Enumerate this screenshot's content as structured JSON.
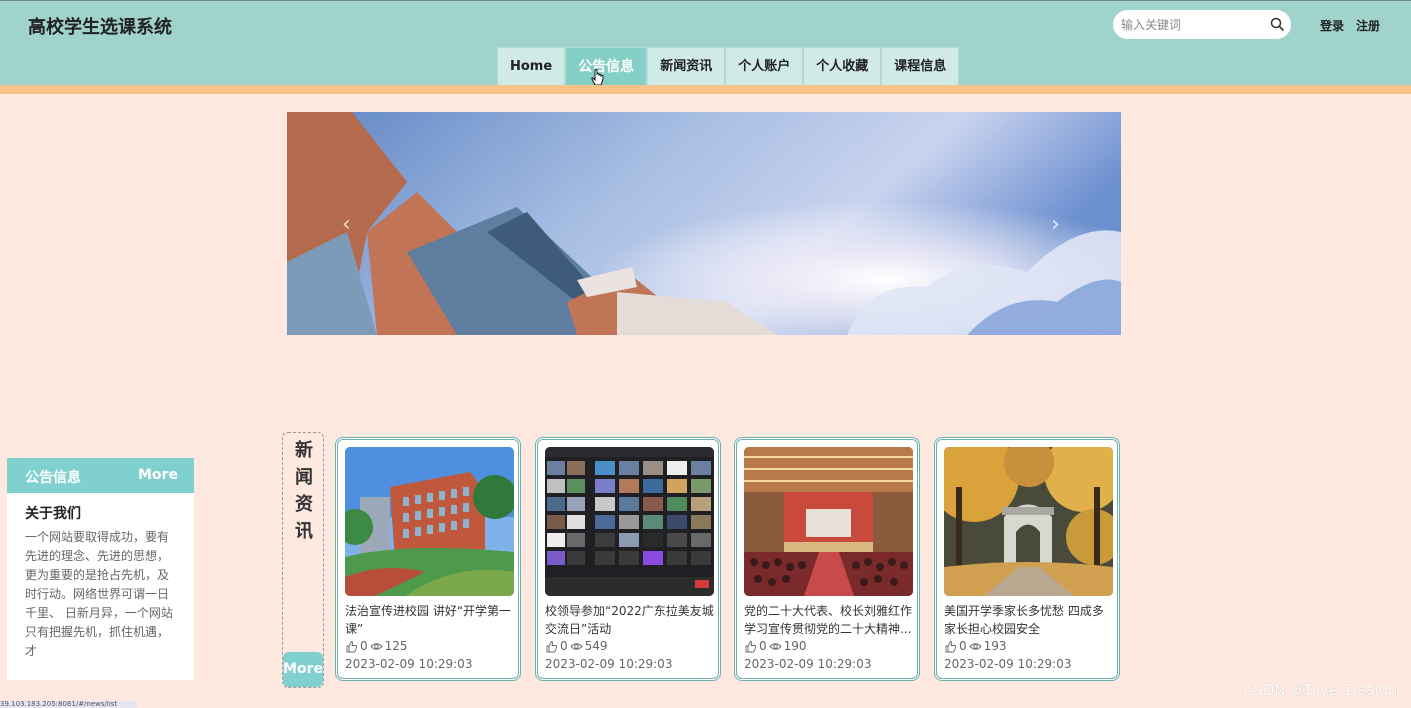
{
  "header": {
    "site_title": "高校学生选课系统",
    "search_placeholder": "输入关键词",
    "login_label": "登录",
    "register_label": "注册"
  },
  "nav": {
    "items": [
      {
        "label": "Home"
      },
      {
        "label": "公告信息",
        "active": true
      },
      {
        "label": "新闻资讯"
      },
      {
        "label": "个人账户"
      },
      {
        "label": "个人收藏"
      },
      {
        "label": "课程信息"
      }
    ]
  },
  "banner": {
    "prev_arrow": "‹",
    "next_arrow": "›"
  },
  "notice": {
    "title": "公告信息",
    "more_label": "More",
    "about_title": "关于我们",
    "about_text": "一个网站要取得成功，要有先进的理念、先进的思想，更为重要的是抢占先机，及时行动。网络世界可谓一日千里、 日新月异，一个网站只有把握先机，抓住机遇，才"
  },
  "news": {
    "section_label": "新闻资讯",
    "more_label": "More",
    "items": [
      {
        "title": "法治宣传进校园 讲好“开学第一课”",
        "likes": "0",
        "views": "125",
        "date": "2023-02-09 10:29:03"
      },
      {
        "title": "校领导参加“2022广东拉美友城交流日”活动",
        "likes": "0",
        "views": "549",
        "date": "2023-02-09 10:29:03"
      },
      {
        "title": "党的二十大代表、校长刘雅红作学习宣传贯彻党的二十大精神...",
        "likes": "0",
        "views": "190",
        "date": "2023-02-09 10:29:03"
      },
      {
        "title": "美国开学季家长多忧愁 四成多家长担心校园安全",
        "likes": "0",
        "views": "193",
        "date": "2023-02-09 10:29:03"
      }
    ]
  },
  "status_bar": {
    "url": "39.103.183.205:8081/#/news/list"
  },
  "watermark": "CSDN @Biye_Design",
  "colors": {
    "topbar": "#9fd3cc",
    "accent": "#7fd0cf",
    "strip": "#f8c387",
    "page_bg": "#fde9e0"
  }
}
